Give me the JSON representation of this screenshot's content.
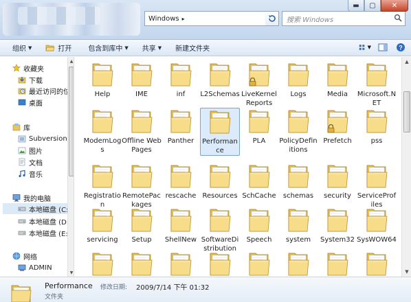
{
  "address": {
    "path": "Windows",
    "search_placeholder": "搜索 Windows"
  },
  "toolbar": {
    "organize": "组织",
    "open": "打开",
    "include": "包含到库中",
    "share": "共享",
    "new_folder": "新建文件夹"
  },
  "nav": {
    "favorites_header": "收藏夹",
    "favorites": [
      "下载",
      "最近访问的位",
      "桌面"
    ],
    "libraries_header": "库",
    "libraries": [
      "Subversion",
      "图片",
      "文档",
      "音乐"
    ],
    "computer_header": "我的电脑",
    "drives": [
      "本地磁盘 (C:)",
      "本地磁盘 (D:)",
      "本地磁盘 (E:)"
    ],
    "network_header": "网络",
    "network": [
      "ADMIN"
    ]
  },
  "folders": [
    [
      "Help",
      "IME",
      "inf",
      "L2Schemas",
      "LiveKernelReports",
      "Logs",
      "Media",
      "Microsoft.NET"
    ],
    [
      "ModemLogs",
      "Offline Web Pages",
      "Panther",
      "Performance",
      "PLA",
      "PolicyDefinitions",
      "Prefetch",
      "pss"
    ],
    [
      "Registration",
      "RemotePackages",
      "rescache",
      "Resources",
      "SchCache",
      "schemas",
      "security",
      "ServiceProfiles"
    ],
    [
      "servicing",
      "Setup",
      "ShellNew",
      "SoftwareDistribution",
      "Speech",
      "system",
      "System32",
      "SysWOW64"
    ]
  ],
  "details": {
    "name": "Performance",
    "modified_label": "修改日期:",
    "modified_value": "2009/7/14 下午 01:32",
    "type": "文件夹"
  }
}
